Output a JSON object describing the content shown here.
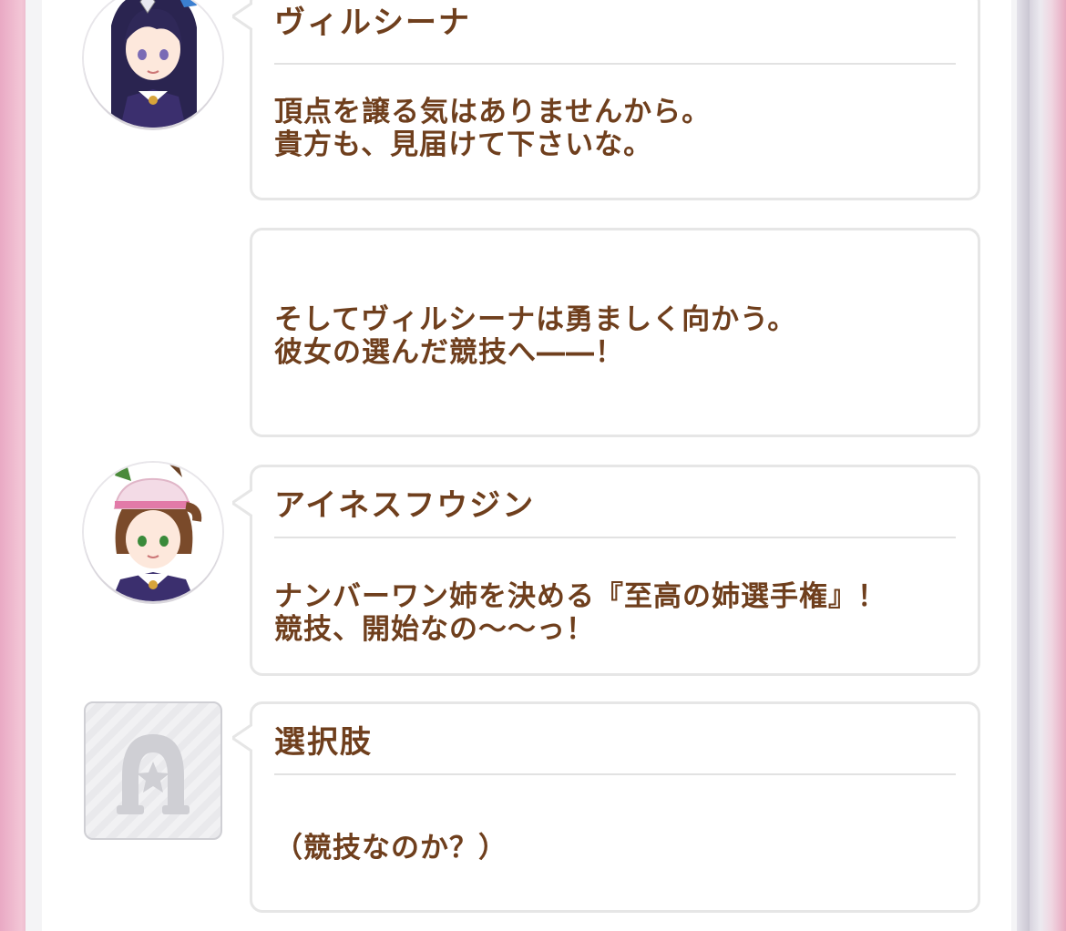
{
  "log": [
    {
      "speaker": "ヴィルシーナ",
      "text": "頂点を譲る気はありませんから。\n貴方も、見届けて下さいな。",
      "avatar_icon": "vivlos-character-avatar"
    },
    {
      "speaker": "",
      "text": "そしてヴィルシーナは勇ましく向かう。\n彼女の選んだ競技へ――！"
    },
    {
      "speaker": "アイネスフウジン",
      "text": "ナンバーワン姉を決める『至高の姉選手権』！\n競技、開始なの～～っ！",
      "avatar_icon": "ines-fujin-character-avatar"
    },
    {
      "speaker": "選択肢",
      "text": "（競技なのか？）",
      "avatar_icon": "horseshoe-star-icon"
    }
  ],
  "colors": {
    "text_brown": "#6f3f1d",
    "bubble_border": "#e6e6e6",
    "panel_bg": "#ffffff"
  }
}
